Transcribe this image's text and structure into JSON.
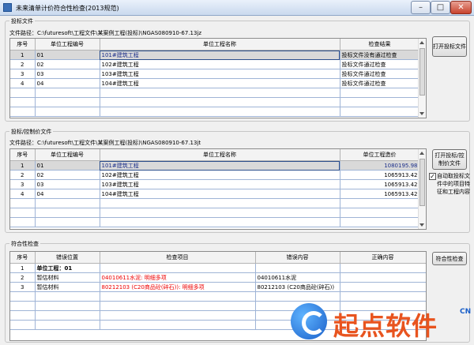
{
  "window": {
    "title": "未来清单计价符合性检查(2013规范)",
    "min": "–",
    "max": "□",
    "close": "✕"
  },
  "bid_file": {
    "legend": "投标文件",
    "path": "文件路径：C:\\futuresoft\\工程文件\\某案例工程(投标)\\NGAS080910-67.13jz",
    "columns": [
      "序号",
      "单位工程编号",
      "单位工程名称",
      "检查结果"
    ],
    "rows": [
      {
        "no": "1",
        "code": "01",
        "name": "101#建筑工程",
        "result": "投标文件没有通过检查"
      },
      {
        "no": "2",
        "code": "02",
        "name": "102#建筑工程",
        "result": "投标文件通过检查"
      },
      {
        "no": "3",
        "code": "03",
        "name": "103#建筑工程",
        "result": "投标文件通过检查"
      },
      {
        "no": "4",
        "code": "04",
        "name": "104#建筑工程",
        "result": "投标文件通过检查"
      }
    ],
    "open_button": "打开投标文件"
  },
  "control_file": {
    "legend": "投标/控制价文件",
    "path": "文件路径：C:\\futuresoft\\工程文件\\某案例工程(投标)\\NGAS080910-67.13jt",
    "columns": [
      "序号",
      "单位工程编号",
      "单位工程名称",
      "单位工程造价"
    ],
    "rows": [
      {
        "no": "1",
        "code": "01",
        "name": "101#建筑工程",
        "price": "1080195.98"
      },
      {
        "no": "2",
        "code": "02",
        "name": "102#建筑工程",
        "price": "1065913.42"
      },
      {
        "no": "3",
        "code": "03",
        "name": "103#建筑工程",
        "price": "1065913.42"
      },
      {
        "no": "4",
        "code": "04",
        "name": "104#建筑工程",
        "price": "1065913.42"
      }
    ],
    "open_button": "打开投标/控制价文件",
    "auto_checkbox_label": "自动取投标文件中的项目特征和工程内容",
    "auto_checked": true
  },
  "check": {
    "legend": "符合性检查",
    "columns": [
      "序号",
      "错误位置",
      "检查项目",
      "错误内容",
      "正确内容"
    ],
    "rows": [
      {
        "no": "1",
        "location": "单位工程：01",
        "item": "",
        "error": "",
        "correct": ""
      },
      {
        "no": "2",
        "location": "暂估材料",
        "item": "04010611水泥: 明细多项",
        "error": "04010611水泥",
        "correct": ""
      },
      {
        "no": "3",
        "location": "暂估材料",
        "item": "80212103 (C20商品砼(碎石)): 明细多项",
        "error": "80212103 (C20商品砼(碎石))",
        "correct": ""
      }
    ],
    "button": "符合性检查"
  },
  "brand": {
    "name": "起点软件",
    "suffix": "CN"
  }
}
